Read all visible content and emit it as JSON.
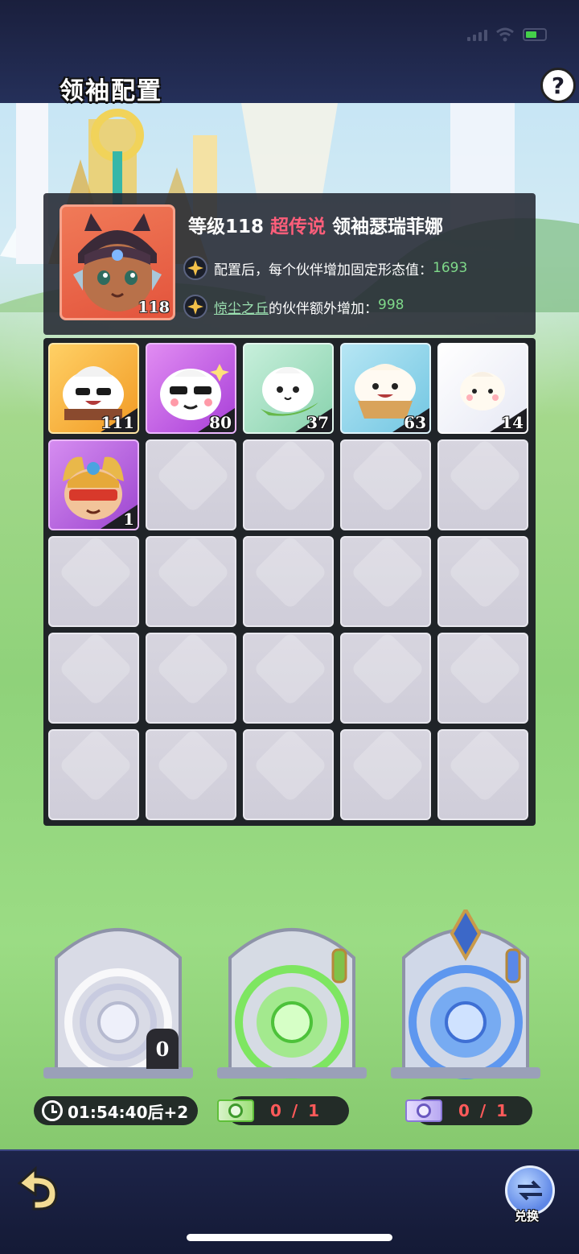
{
  "status_bar": {
    "signal_icon": "cellular-signal-icon",
    "wifi_icon": "wifi-icon",
    "battery_icon": "battery-charging-icon",
    "battery_color": "#44d04a"
  },
  "header": {
    "title": "领袖配置",
    "help_label": "?"
  },
  "leader": {
    "level_text": "等级118",
    "rarity": "超传说",
    "name": "领袖瑟瑞菲娜",
    "portrait_level": "118",
    "rarity_color": "#ff5e7a",
    "bonus_1": {
      "text": "配置后，每个伙伴增加固定形态值：",
      "value": "1693"
    },
    "bonus_2": {
      "place": "惊尘之丘",
      "text": "的伙伴额外增加：",
      "value": "998"
    },
    "bonus_value_color": "#7fd98a"
  },
  "partners": [
    {
      "name": "dumpling-sunglasses-muscle",
      "level": "111",
      "bg": "#f5b23a"
    },
    {
      "name": "dumpling-sunglasses-purple",
      "level": "80",
      "bg": "#c25ce8"
    },
    {
      "name": "dumpling-leaf",
      "level": "37",
      "bg": "#a6e0c2"
    },
    {
      "name": "dumpling-muffin",
      "level": "63",
      "bg": "#8fd5ea"
    },
    {
      "name": "dumpling-plain",
      "level": "14",
      "bg": "#eef0f8"
    },
    {
      "name": "dumpling-warrior-mask",
      "level": "1",
      "bg": "#b05bd6"
    }
  ],
  "summon": {
    "timer_text": "01:54:40后+2",
    "white_count": "0",
    "green_ratio": "0 / 1",
    "blue_ratio": "0 / 1"
  },
  "bottom": {
    "back_icon": "back-arrow-icon",
    "exchange_label": "兑换",
    "exchange_icon": "exchange-icon"
  }
}
